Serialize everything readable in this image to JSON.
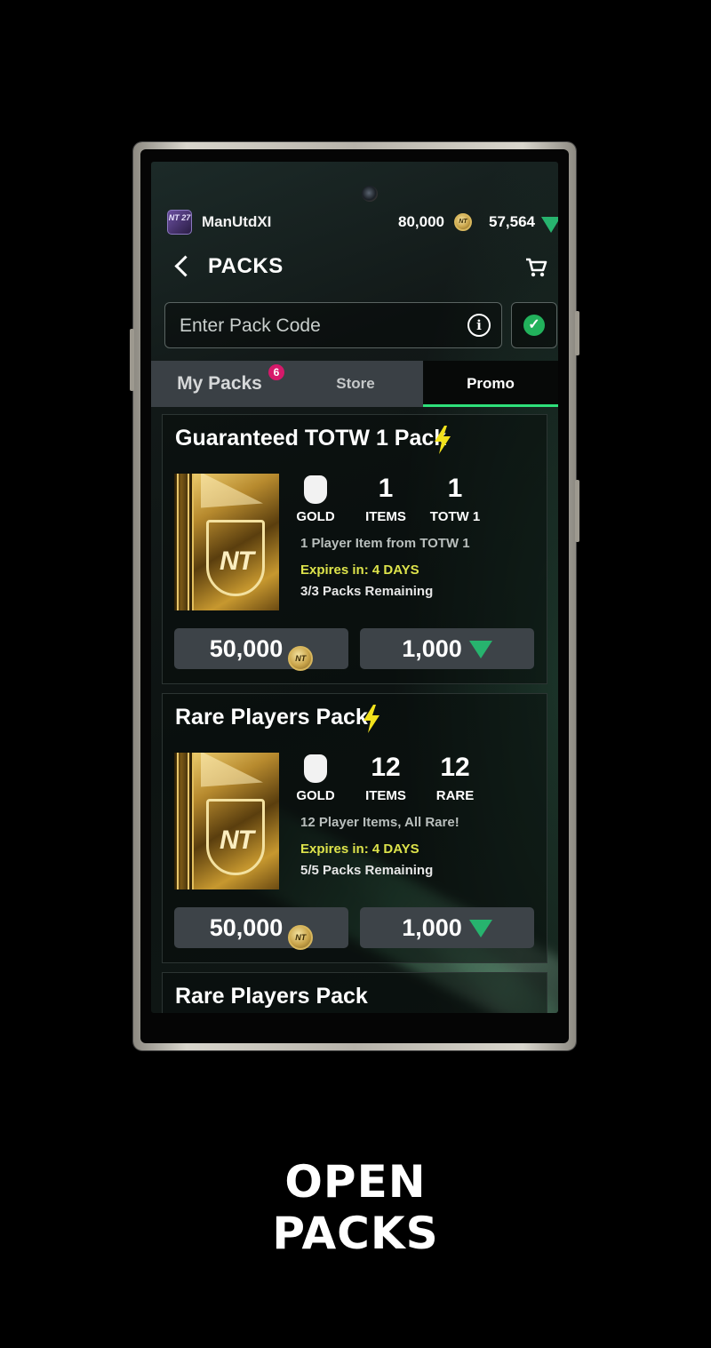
{
  "status": {
    "avatar_text": "NT 27",
    "username": "ManUtdXI",
    "coins": "80,000",
    "points": "57,564",
    "coin_icon_text": "NT"
  },
  "header": {
    "title": "PACKS"
  },
  "code_input": {
    "placeholder": "Enter Pack Code"
  },
  "tabs": {
    "my_packs": "My Packs",
    "my_packs_badge": "6",
    "store": "Store",
    "promo": "Promo",
    "active": "Promo"
  },
  "packs": [
    {
      "title": "Guaranteed TOTW 1 Pack",
      "art_text": "NT",
      "stat1_label": "GOLD",
      "stat2_value": "1",
      "stat2_label": "ITEMS",
      "stat3_value": "1",
      "stat3_label": "TOTW 1",
      "description": "1 Player Item from TOTW 1",
      "expires": "Expires in: 4 DAYS",
      "remaining": "3/3 Packs Remaining",
      "coin_price": "50,000",
      "points_price": "1,000"
    },
    {
      "title": "Rare Players Pack",
      "art_text": "NT",
      "stat1_label": "GOLD",
      "stat2_value": "12",
      "stat2_label": "ITEMS",
      "stat3_value": "12",
      "stat3_label": "RARE",
      "description": "12 Player Items, All Rare!",
      "expires": "Expires in: 4 DAYS",
      "remaining": "5/5 Packs Remaining",
      "coin_price": "50,000",
      "points_price": "1,000"
    },
    {
      "title": "Rare Players Pack"
    }
  ],
  "caption": {
    "line1": "OPEN",
    "line2": "PACKS"
  },
  "colors": {
    "accent_green": "#2ee07a",
    "expires_yellow": "#dde34b",
    "badge_pink": "#d6196a",
    "bolt_yellow": "#f2e21c"
  }
}
